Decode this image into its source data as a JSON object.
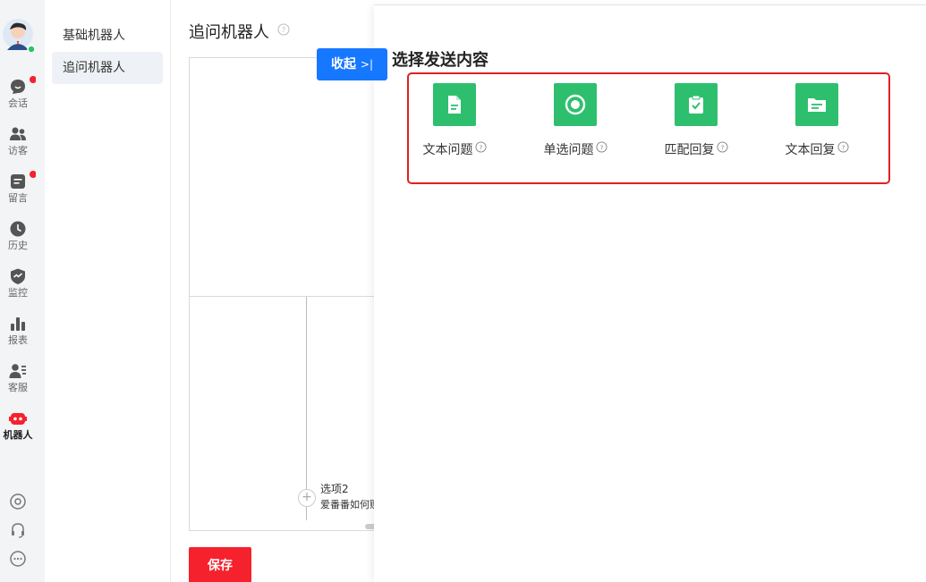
{
  "sidebar": {
    "items": [
      {
        "label": "会话",
        "icon": "chat-icon",
        "badge": true
      },
      {
        "label": "访客",
        "icon": "visitors-icon",
        "badge": false
      },
      {
        "label": "留言",
        "icon": "message-icon",
        "badge": true
      },
      {
        "label": "历史",
        "icon": "clock-icon",
        "badge": false
      },
      {
        "label": "监控",
        "icon": "monitor-shield-icon",
        "badge": false
      },
      {
        "label": "报表",
        "icon": "bar-chart-icon",
        "badge": false
      },
      {
        "label": "客服",
        "icon": "agent-icon",
        "badge": false
      },
      {
        "label": "机器人",
        "icon": "robot-icon",
        "badge": false,
        "active": true
      }
    ],
    "bottom_icons": [
      "settings-icon",
      "headset-icon",
      "more-icon"
    ]
  },
  "submenu": {
    "items": [
      {
        "label": "基础机器人"
      },
      {
        "label": "追问机器人",
        "active": true
      }
    ]
  },
  "main": {
    "title": "追问机器人",
    "option_title": "选项2",
    "option_desc": "爱番番如何购",
    "save_label": "保存"
  },
  "collapse": {
    "label": "收起",
    "arrow": ">|"
  },
  "drawer": {
    "title": "选择发送内容",
    "options": [
      {
        "label": "文本问题",
        "icon": "document-icon"
      },
      {
        "label": "单选问题",
        "icon": "radio-icon"
      },
      {
        "label": "匹配回复",
        "icon": "clipboard-check-icon"
      },
      {
        "label": "文本回复",
        "icon": "folder-text-icon"
      }
    ]
  },
  "colors": {
    "accent_blue": "#1677ff",
    "save_red": "#f5222d",
    "tile_green": "#2ebf6e",
    "highlight_red": "#e02020",
    "badge_red": "#f5222d"
  }
}
